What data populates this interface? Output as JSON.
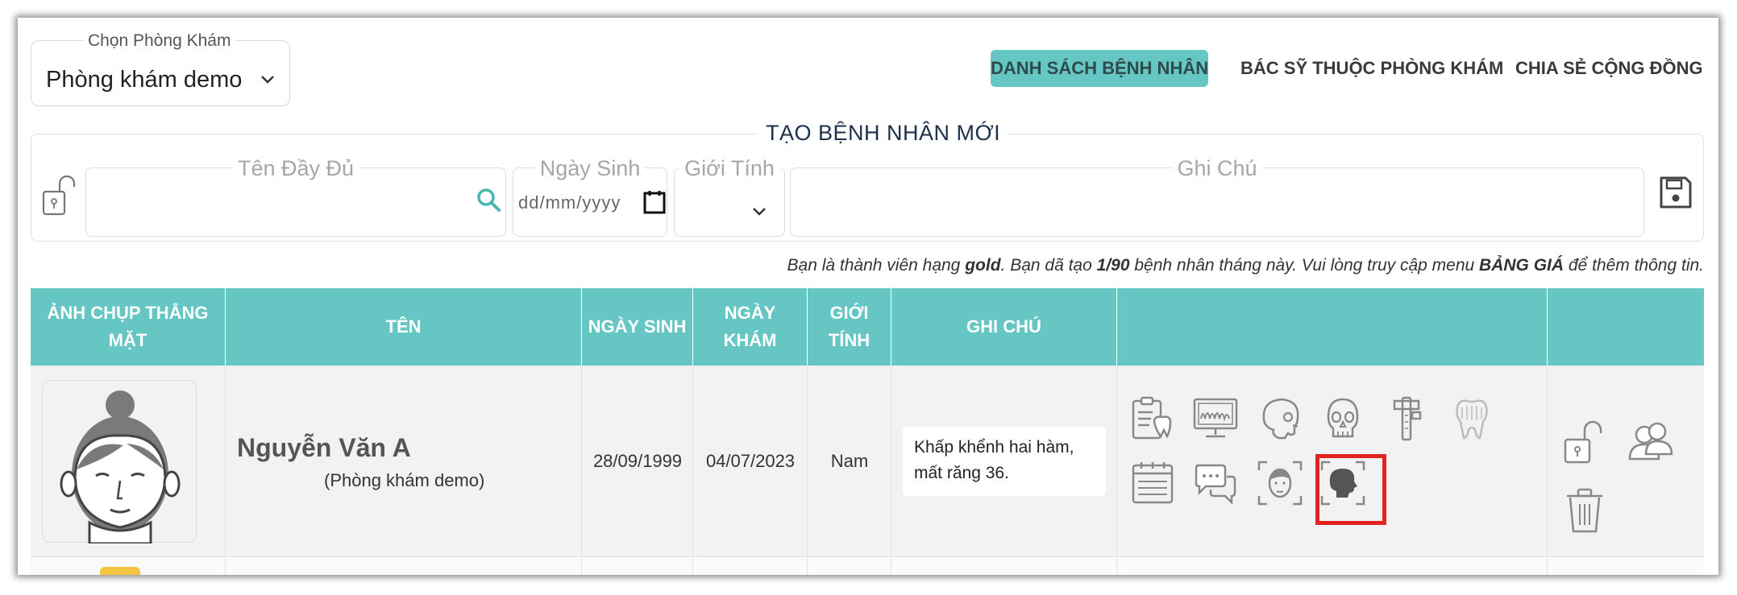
{
  "clinic_selector": {
    "label": "Chọn Phòng Khám",
    "value": "Phòng khám demo"
  },
  "nav": [
    {
      "label": "DANH SÁCH BỆNH NHÂN",
      "active": true
    },
    {
      "label": "BÁC SỸ THUỘC PHÒNG KHÁM",
      "active": false
    },
    {
      "label": "CHIA SẺ CỘNG ĐỒNG",
      "active": false
    }
  ],
  "form": {
    "title": "TẠO BỆNH NHÂN MỚI",
    "fields": {
      "name": {
        "label": "Tên Đầy Đủ",
        "value": ""
      },
      "dob": {
        "label": "Ngày Sinh",
        "placeholder": "dd/mm/yyyy"
      },
      "gender": {
        "label": "Giới Tính",
        "value": ""
      },
      "note": {
        "label": "Ghi Chú",
        "value": ""
      }
    }
  },
  "notice": {
    "p1": "Bạn là thành viên hạng ",
    "tier": "gold",
    "p2": ".  Bạn dã tạo ",
    "count": "1/90",
    "p3": " bệnh nhân tháng này.  Vui lòng truy cập menu ",
    "menu": "BẢNG GIÁ",
    "p4": " để thêm thông tin."
  },
  "table": {
    "headers": [
      "ẢNH CHỤP THẲNG MẶT",
      "TÊN",
      "NGÀY SINH",
      "NGÀY KHÁM",
      "GIỚI TÍNH",
      "GHI CHÚ",
      "",
      ""
    ],
    "rows": [
      {
        "name": "Nguyễn Văn A",
        "clinic": "(Phòng khám demo)",
        "dob": "28/09/1999",
        "visit_date": "04/07/2023",
        "gender": "Nam",
        "note": "Khấp khểnh hai hàm, mất răng 36."
      }
    ]
  },
  "row_tools": [
    "dental-chart-icon",
    "xray-monitor-icon",
    "skull-side-icon",
    "skull-front-icon",
    "caliper-icon",
    "tooth-icon",
    "calendar-icon",
    "chat-icon",
    "face-scan-icon",
    "profile-scan-icon"
  ],
  "row_actions": [
    "unlock-icon",
    "share-users-icon",
    "trash-icon"
  ],
  "colors": {
    "header_teal": "#66c6c3",
    "highlight_red": "#e32222",
    "title_navy": "#1e2f4a"
  }
}
